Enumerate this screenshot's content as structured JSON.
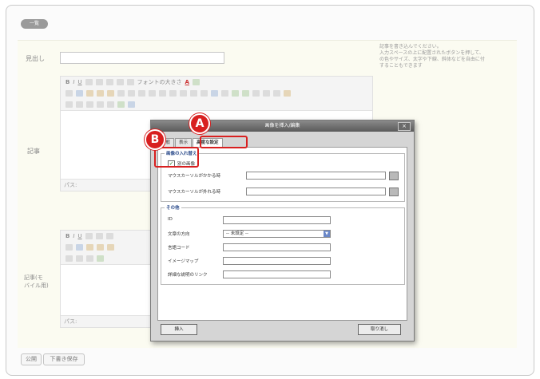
{
  "list_button": "一覧",
  "fields": {
    "midashi_label": "見出し",
    "kiji_label": "記事",
    "kiji_mobile_label": "記事(モ\nバイル用)"
  },
  "hint": "記事を書き込んでください。\n入力スペースの上に配置されたボタンを押して、\nの色やサイズ、太字や下線、斜体などを自由に付\nすることもできます",
  "editor_toolbar": {
    "font_size": "フォントの大きさ",
    "text_color": "A",
    "path_label": "パス:"
  },
  "bottom_buttons": {
    "publish": "公開",
    "draft": "下書き保存"
  },
  "dialog": {
    "title": "画像を挿入/編集",
    "close": "×",
    "tabs": [
      "全般",
      "表示",
      "高度な設定"
    ],
    "swap_legend": "画像の入れ替え",
    "alt_image_label": "別の画像",
    "alt_image_checked": true,
    "mouseover_label": "マウスカーソルがかかる時",
    "mouseout_label": "マウスカーソルが外れる時",
    "other_legend": "その他",
    "id_label": "ID",
    "dir_label": "文章の方向",
    "dir_value": "-- 未設定 --",
    "lang_label": "言語コード",
    "imagemap_label": "イメージマップ",
    "longdesc_label": "詳細な説明のリンク",
    "insert_button": "挿入",
    "cancel_button": "取り消し"
  },
  "badges": {
    "a": "A",
    "b": "B"
  },
  "colors": {
    "badge": "#d82020",
    "legend": "#2a4a8a"
  }
}
